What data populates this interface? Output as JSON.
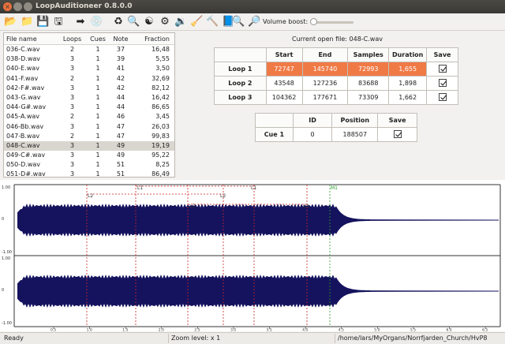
{
  "window": {
    "title": "LoopAuditioneer 0.8.0.0"
  },
  "toolbar": {
    "buttons": [
      {
        "name": "open-folder-icon",
        "glyph": "📂"
      },
      {
        "name": "open-file-icon",
        "glyph": "📁"
      },
      {
        "name": "save-icon",
        "glyph": "💾"
      },
      {
        "name": "save-as-icon",
        "glyph": "🖫"
      },
      {
        "name": "arrow-right-icon",
        "glyph": "➡"
      },
      {
        "name": "cd-icon",
        "glyph": "💿"
      },
      {
        "name": "autoloop-icon",
        "glyph": "♻"
      },
      {
        "name": "search-icon",
        "glyph": "🔍"
      },
      {
        "name": "crossfade-icon",
        "glyph": "☯"
      },
      {
        "name": "settings-icon",
        "glyph": "⚙"
      },
      {
        "name": "audio-icon",
        "glyph": "🔉"
      },
      {
        "name": "broom-icon",
        "glyph": "🧹"
      },
      {
        "name": "hammer-icon",
        "glyph": "🔨"
      },
      {
        "name": "book-icon",
        "glyph": "📘"
      },
      {
        "name": "zoom-in-icon",
        "glyph": "🔍"
      },
      {
        "name": "zoom-out-icon",
        "glyph": "🔎"
      }
    ],
    "volume_label": "Volume boost:"
  },
  "filelist": {
    "headers": [
      "File name",
      "Loops",
      "Cues",
      "Note",
      "Fraction"
    ],
    "rows": [
      [
        "036-C.wav",
        "2",
        "1",
        "37",
        "16,48"
      ],
      [
        "038-D.wav",
        "3",
        "1",
        "39",
        "5,55"
      ],
      [
        "040-E.wav",
        "3",
        "1",
        "41",
        "3,50"
      ],
      [
        "041-F.wav",
        "2",
        "1",
        "42",
        "32,69"
      ],
      [
        "042-F#.wav",
        "3",
        "1",
        "42",
        "82,12"
      ],
      [
        "043-G.wav",
        "3",
        "1",
        "44",
        "16,42"
      ],
      [
        "044-G#.wav",
        "3",
        "1",
        "44",
        "86,65"
      ],
      [
        "045-A.wav",
        "2",
        "1",
        "46",
        "3,45"
      ],
      [
        "046-Bb.wav",
        "3",
        "1",
        "47",
        "26,03"
      ],
      [
        "047-B.wav",
        "2",
        "1",
        "47",
        "99,83"
      ],
      [
        "048-C.wav",
        "3",
        "1",
        "49",
        "19,19"
      ],
      [
        "049-C#.wav",
        "3",
        "1",
        "49",
        "95,22"
      ],
      [
        "050-D.wav",
        "3",
        "1",
        "51",
        "8,25"
      ],
      [
        "051-D#.wav",
        "3",
        "1",
        "51",
        "86,49"
      ]
    ],
    "selected_index": 10
  },
  "current_file": "Current open file: 048-C.wav",
  "loops": {
    "headers": [
      "",
      "Start",
      "End",
      "Samples",
      "Duration",
      "Save"
    ],
    "rows": [
      {
        "label": "Loop 1",
        "start": "72747",
        "end": "145740",
        "samples": "72993",
        "duration": "1,655",
        "save": true
      },
      {
        "label": "Loop 2",
        "start": "43548",
        "end": "127236",
        "samples": "83688",
        "duration": "1,898",
        "save": true
      },
      {
        "label": "Loop 3",
        "start": "104362",
        "end": "177671",
        "samples": "73309",
        "duration": "1,662",
        "save": true
      }
    ],
    "highlighted_index": 0
  },
  "cues": {
    "headers": [
      "",
      "ID",
      "Position",
      "Save"
    ],
    "rows": [
      {
        "label": "Cue 1",
        "id": "0",
        "position": "188507",
        "save": true
      }
    ]
  },
  "waveform": {
    "channel_labels": [
      "1.00",
      "0",
      "-1.00",
      "1.00",
      "0",
      "-1.00"
    ],
    "markers": [
      "L2",
      "L1",
      "L3",
      "L2",
      "L1",
      "L3",
      "M1"
    ],
    "time_ticks": [
      "0.5",
      "1.0",
      "1.5",
      "2.0",
      "2.5",
      "3.0",
      "3.5",
      "4.0",
      "4.5",
      "5.0",
      "5.5",
      "6.0",
      "6.5"
    ],
    "colors": {
      "wave": "#15135e",
      "loop_line": "#cc2222",
      "cue_line": "#2a9a2a",
      "background": "#ffffff"
    }
  },
  "status": {
    "left": "Ready",
    "zoom": "Zoom level: x 1",
    "path": "/home/lars/MyOrgans/Norrfjarden_Church/HvP8"
  }
}
